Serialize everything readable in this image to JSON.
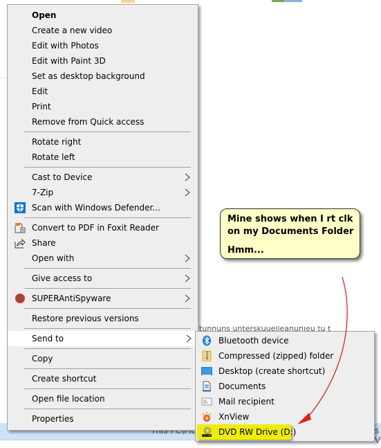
{
  "background": {
    "status_path": "This PC\\Pict",
    "status_right": "s V",
    "behind_text": "tunnuns unterskuuelleanunieu tu tuuie"
  },
  "context_menu": {
    "items": [
      {
        "label": "Open",
        "bold": true
      },
      {
        "label": "Create a new video"
      },
      {
        "label": "Edit with Photos"
      },
      {
        "label": "Edit with Paint 3D"
      },
      {
        "label": "Set as desktop background"
      },
      {
        "label": "Edit"
      },
      {
        "label": "Print"
      },
      {
        "label": "Remove from Quick access"
      },
      {
        "label": "Rotate right"
      },
      {
        "label": "Rotate left"
      },
      {
        "label": "Cast to Device",
        "submenu": true
      },
      {
        "label": "7-Zip",
        "submenu": true
      },
      {
        "label": "Scan with Windows Defender...",
        "icon": "windows-defender-shield-icon"
      },
      {
        "label": "Convert to PDF in Foxit Reader",
        "icon": "foxit-pdf-icon"
      },
      {
        "label": "Share",
        "icon": "share-icon"
      },
      {
        "label": "Open with",
        "submenu": true
      },
      {
        "label": "Give access to",
        "submenu": true
      },
      {
        "label": "SUPERAntiSpyware",
        "icon": "superantispyware-icon",
        "submenu": true
      },
      {
        "label": "Restore previous versions"
      },
      {
        "label": "Send to",
        "submenu": true,
        "highlighted": true
      },
      {
        "label": "Copy"
      },
      {
        "label": "Create shortcut"
      },
      {
        "label": "Open file location"
      },
      {
        "label": "Properties"
      }
    ]
  },
  "send_to_menu": {
    "items": [
      {
        "label": "Bluetooth device",
        "icon": "bluetooth-icon"
      },
      {
        "label": "Compressed (zipped) folder",
        "icon": "zip-folder-icon"
      },
      {
        "label": "Desktop (create shortcut)",
        "icon": "desktop-icon"
      },
      {
        "label": "Documents",
        "icon": "documents-icon"
      },
      {
        "label": "Mail recipient",
        "icon": "mail-icon"
      },
      {
        "label": "XnView",
        "icon": "xnview-icon"
      },
      {
        "label": "DVD RW Drive (D:)",
        "icon": "dvd-drive-icon",
        "highlighted": true
      }
    ]
  },
  "annotation": {
    "line1": "Mine shows when I rt clk",
    "line2": "on my Documents Folder",
    "line3": "Hmm...",
    "highlight_color": "#eeee00",
    "callout_color": "#ffffc8",
    "arrow_color": "#e02020"
  }
}
